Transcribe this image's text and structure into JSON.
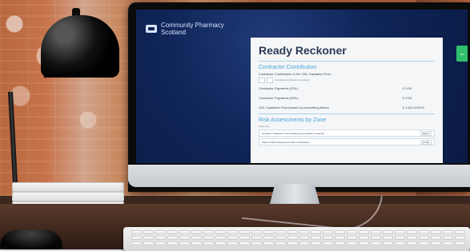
{
  "photo": {
    "objects": {
      "lamp": "desk-lamp",
      "books": "stack-of-books",
      "monitor": "desktop-monitor",
      "keyboard": "keyboard"
    }
  },
  "screen": {
    "brand": {
      "line1": "Community Pharmacy",
      "line2": "Scotland"
    },
    "panel": {
      "title": "Ready Reckoner",
      "section1_title": "Contractor Contribution",
      "section1_subtitle": "Contractor Contribution to the GSL Capitation Pool",
      "section1_hint": "Calculate contribution per patient",
      "mini_inputs": [
        "0",
        "0"
      ],
      "rows": [
        {
          "label": "Contractor Payments (GSL)",
          "value": "£ 0.00"
        },
        {
          "label": "Contractor Payments (GSL)",
          "value": "£ 0.00"
        },
        {
          "label": "GSL Capitation Pool (based on prescribing items)",
          "value": "£ 2,621,578.00"
        }
      ],
      "section2_title": "Risk Assessments by Zone",
      "section2_hint": "Zone size",
      "fields": [
        {
          "label": "Number of Patients in Zone (based on population covered)",
          "button": "Select"
        },
        {
          "label": "Value of Risk Assessment (GSL contribution)",
          "button": "£ 0.00"
        }
      ]
    },
    "side_tab": "Go"
  }
}
